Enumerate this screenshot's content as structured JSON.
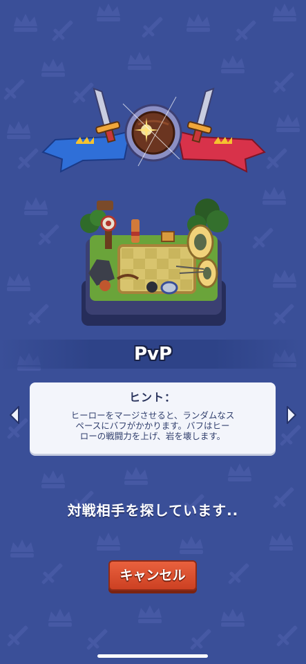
{
  "mode": {
    "title": "PvP"
  },
  "hint": {
    "title": "ヒント：",
    "line1": "ヒーローをマージさせると、ランダムなス",
    "line2": "ペースにバフがかかります。バフはヒー",
    "line3": "ローの戦闘力を上げ、岩を壊します。"
  },
  "status": {
    "searching": "対戦相手を探しています.."
  },
  "buttons": {
    "cancel": "キャンセル"
  },
  "colors": {
    "background": "#3a4f98",
    "pattern": "#4659a4",
    "cancel_button": "#dc5230",
    "blue_ribbon": "#2f6fd8",
    "red_ribbon": "#d8324a"
  },
  "icons": {
    "background_pattern": [
      "crown-icon",
      "sword-icon"
    ],
    "nav_left": "chevron-left-icon",
    "nav_right": "chevron-right-icon"
  }
}
